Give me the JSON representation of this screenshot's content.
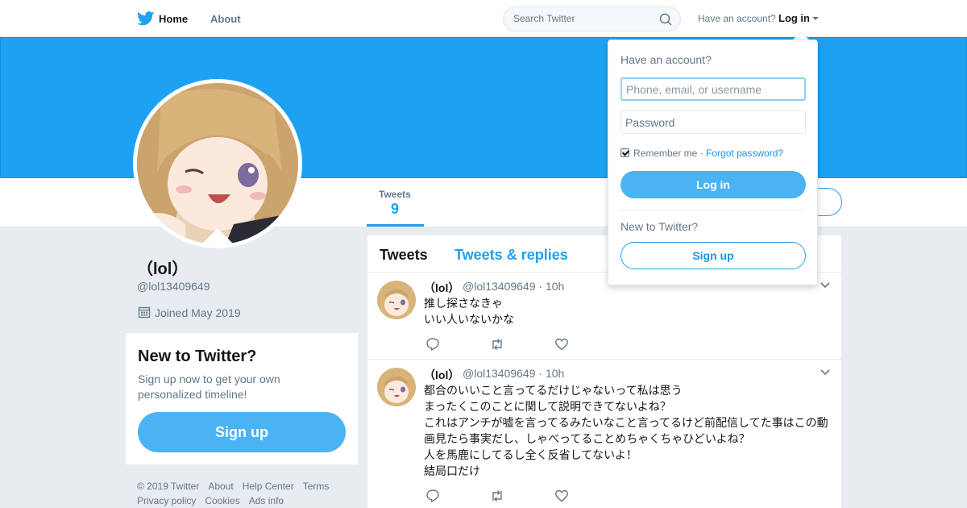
{
  "nav": {
    "home_label": "Home",
    "about_label": "About",
    "search_placeholder": "Search Twitter",
    "have_account": "Have an account?",
    "login_label": "Log in"
  },
  "profile": {
    "display_name": "（lol）",
    "handle": "@lol13409649",
    "joined": "Joined May 2019",
    "stats": [
      {
        "label": "Tweets",
        "value": "9"
      }
    ]
  },
  "signup_card": {
    "title": "New to Twitter?",
    "description": "Sign up now to get your own personalized timeline!",
    "button": "Sign up"
  },
  "footer": {
    "links": [
      "© 2019 Twitter",
      "About",
      "Help Center",
      "Terms",
      "Privacy policy",
      "Cookies",
      "Ads info"
    ]
  },
  "timeline": {
    "tabs": [
      "Tweets",
      "Tweets & replies"
    ],
    "tweets": [
      {
        "name": "（lol）",
        "handle": "@lol13409649 · 10h",
        "lines": [
          "推し探さなきゃ",
          "いい人いないかな"
        ]
      },
      {
        "name": "（lol）",
        "handle": "@lol13409649 · 10h",
        "lines": [
          "都合のいいこと言ってるだけじゃないって私は思う",
          "まったくこのことに関して説明できてないよね？",
          "これはアンチが嘘を言ってるみたいなこと言ってるけど前配信してた事はこの動",
          "画見たら事実だし、しゃべってることめちゃくちゃひどいよね？",
          "人を馬鹿にしてるし全く反省してないよ！",
          "結局口だけ"
        ]
      }
    ]
  },
  "login_dropdown": {
    "title": "Have an account?",
    "username_placeholder": "Phone, email, or username",
    "password_placeholder": "Password",
    "remember_label": "Remember me",
    "separator": "·",
    "forgot_label": "Forgot password?",
    "login_button": "Log in",
    "new_prompt": "New to Twitter?",
    "signup_button": "Sign up"
  },
  "colors": {
    "brand_blue": "#1da1f2",
    "button_blue": "#4ab3f4",
    "muted_text": "#657786",
    "background": "#e6ecf0"
  },
  "icons": [
    "twitter-bird-icon",
    "search-icon",
    "calendar-icon",
    "reply-icon",
    "retweet-icon",
    "like-icon",
    "chevron-down-icon"
  ]
}
